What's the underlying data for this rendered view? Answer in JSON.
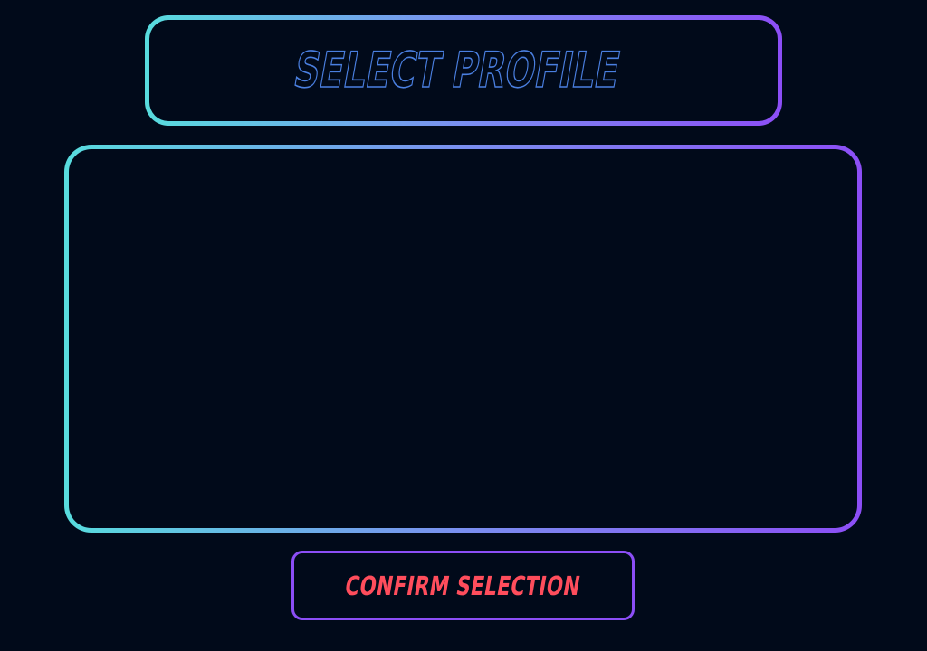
{
  "header": {
    "title": "SELECT PROFILE"
  },
  "profile_list": {
    "items": []
  },
  "actions": {
    "confirm_label": "CONFIRM SELECTION"
  },
  "colors": {
    "background": "#010a1a",
    "gradient_start": "#58dcde",
    "gradient_mid": "#7a8ff0",
    "gradient_end": "#8c4ef6",
    "title_outline": "#4a7fe0",
    "confirm_text": "#ff4d5c",
    "confirm_border": "#8c4ef6"
  }
}
